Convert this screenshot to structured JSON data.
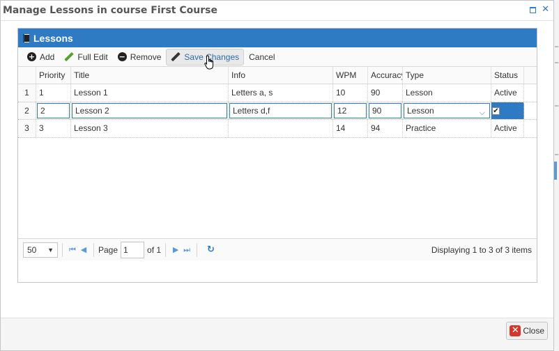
{
  "window": {
    "title": "Manage Lessons in course First Course"
  },
  "panel": {
    "title": "Lessons"
  },
  "toolbar": {
    "add": "Add",
    "full_edit": "Full Edit",
    "remove": "Remove",
    "save_changes": "Save Changes",
    "cancel": "Cancel"
  },
  "grid": {
    "columns": [
      "Priority",
      "Title",
      "Info",
      "WPM",
      "Accuracy",
      "Type",
      "Status"
    ],
    "rows": [
      {
        "num": "1",
        "priority": "1",
        "title": "Lesson 1",
        "info": "Letters a, s",
        "wpm": "10",
        "accuracy": "90",
        "type": "Lesson",
        "status": "Active"
      },
      {
        "num": "2",
        "priority": "2",
        "title": "Lesson 2",
        "info": "Letters d,f",
        "wpm": "12",
        "accuracy": "90",
        "type": "Lesson",
        "status": ""
      },
      {
        "num": "3",
        "priority": "3",
        "title": "Lesson 3",
        "info": "",
        "wpm": "14",
        "accuracy": "94",
        "type": "Practice",
        "status": "Active"
      }
    ]
  },
  "pager": {
    "page_size": "50",
    "page_label": "Page",
    "page_value": "1",
    "of_label": "of 1",
    "display_info": "Displaying 1 to 3 of 3 items"
  },
  "footer": {
    "close": "Close"
  }
}
